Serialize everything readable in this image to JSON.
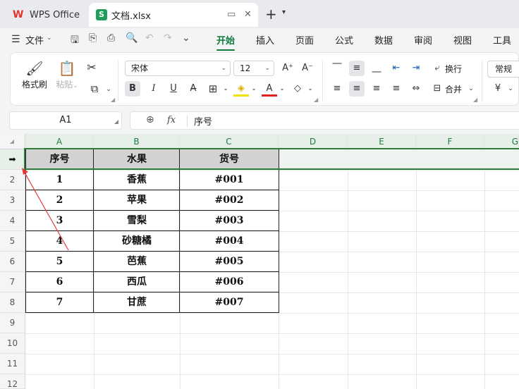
{
  "tabs": {
    "wps_label": "WPS Office",
    "wps_logo": "W",
    "doc_label": "文档.xlsx",
    "doc_logo": "S",
    "add_icon": "+",
    "dropdown_icon": "▾",
    "restore_icon": "▭",
    "close_icon": "✕"
  },
  "menu": {
    "hamburger_icon": "☰",
    "file_label": "文件",
    "file_caret": "⌄",
    "quick_icons": [
      "🖫",
      "⎘",
      "⎙",
      "🔍",
      "↶",
      "↷",
      "⌄"
    ],
    "tabs": [
      "开始",
      "插入",
      "页面",
      "公式",
      "数据",
      "审阅",
      "视图",
      "工具"
    ],
    "active_tab": "开始"
  },
  "ribbon": {
    "format_painter": "格式刷",
    "paste": "粘贴",
    "paste_caret": "⌄",
    "cut_icon": "✂",
    "copy_icon": "⧉",
    "font_name": "宋体",
    "font_size": "12",
    "grow_font": "A⁺",
    "shrink_font": "A⁻",
    "bold": "B",
    "italic": "I",
    "underline": "U",
    "strike": "A̶",
    "border_icon": "⊞",
    "fill_icon": "◈",
    "font_color_icon": "A",
    "clear_icon": "◇",
    "align_top": "⎺",
    "align_middle": "≡",
    "align_bottom": "⎽",
    "indent_dec": "⇤",
    "indent_inc": "⇥",
    "wrap_label": "换行",
    "align_left": "≡",
    "align_center": "≡",
    "align_right": "≡",
    "justify": "≡",
    "distribute": "⇔",
    "merge_label": "合并",
    "number_format": "常规",
    "currency": "¥",
    "caret": "⌄",
    "wrap_icon": "⤶",
    "merge_icon": "⊟",
    "corner_icon": "◢"
  },
  "formula": {
    "cell_ref": "A1",
    "zoom_icon": "⊕",
    "fx_label": "fx",
    "value": "序号",
    "caret": "◢"
  },
  "grid": {
    "columns": [
      "A",
      "B",
      "C",
      "D",
      "E",
      "F",
      "G"
    ],
    "rows": [
      "1",
      "2",
      "3",
      "4",
      "5",
      "6",
      "7",
      "8",
      "9",
      "10",
      "11",
      "12"
    ],
    "headers": [
      "序号",
      "水果",
      "货号"
    ],
    "data": [
      [
        "1",
        "香蕉",
        "#001"
      ],
      [
        "2",
        "苹果",
        "#002"
      ],
      [
        "3",
        "雪梨",
        "#003"
      ],
      [
        "4",
        "砂糖橘",
        "#004"
      ],
      [
        "5",
        "芭蕉",
        "#005"
      ],
      [
        "6",
        "西瓜",
        "#006"
      ],
      [
        "7",
        "甘蔗",
        "#007"
      ]
    ],
    "row_cursor_icon": "➡"
  },
  "colors": {
    "accent": "#0f7b3a",
    "selection": "#2f7d3a",
    "annotation_arrow": "#e53935"
  }
}
